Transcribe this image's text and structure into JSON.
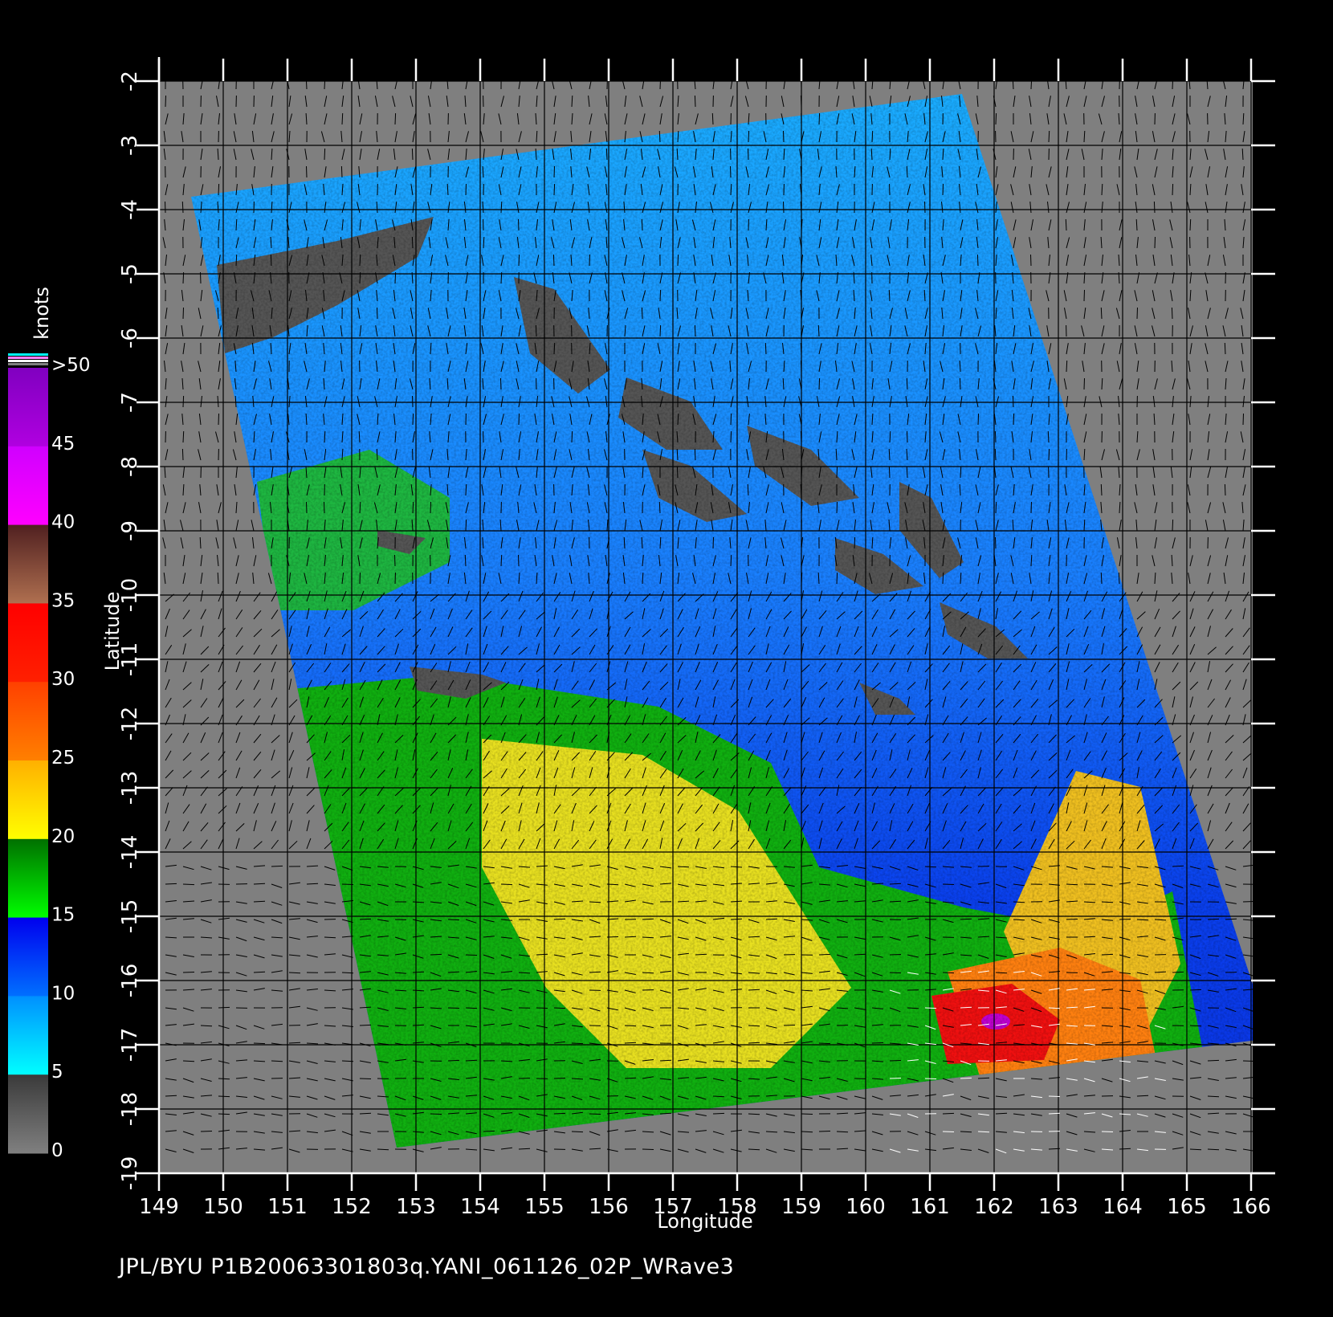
{
  "chart_data": {
    "type": "map",
    "xlabel": "Longitude",
    "ylabel": "Latitude",
    "xlim": [
      149,
      166
    ],
    "ylim": [
      -19,
      -2
    ],
    "x_ticks": [
      149,
      150,
      151,
      152,
      153,
      154,
      155,
      156,
      157,
      158,
      159,
      160,
      161,
      162,
      163,
      164,
      165,
      166
    ],
    "y_ticks": [
      -2,
      -3,
      -4,
      -5,
      -6,
      -7,
      -8,
      -9,
      -10,
      -11,
      -12,
      -13,
      -14,
      -15,
      -16,
      -17,
      -18,
      -19
    ],
    "grid": true,
    "swath_corners_lonlat": [
      [
        149.5,
        -3.8
      ],
      [
        161.5,
        -2.2
      ],
      [
        166.3,
        -16.9
      ],
      [
        152.7,
        -18.6
      ]
    ],
    "colorbar": {
      "unit": "knots",
      "labels": [
        "0",
        "5",
        "10",
        "15",
        "20",
        "25",
        "30",
        "35",
        "40",
        "45",
        ">50"
      ],
      "bands": [
        {
          "from": 0,
          "to": 5,
          "colors": [
            "#808080",
            "#3a3a3a"
          ]
        },
        {
          "from": 5,
          "to": 10,
          "colors": [
            "#00ffff",
            "#0090ff"
          ]
        },
        {
          "from": 10,
          "to": 15,
          "colors": [
            "#0070ff",
            "#0000ee"
          ]
        },
        {
          "from": 15,
          "to": 20,
          "colors": [
            "#00ff00",
            "#007000"
          ]
        },
        {
          "from": 20,
          "to": 25,
          "colors": [
            "#ffff00",
            "#ffb000"
          ]
        },
        {
          "from": 25,
          "to": 30,
          "colors": [
            "#ff8000",
            "#ff4000"
          ]
        },
        {
          "from": 30,
          "to": 35,
          "colors": [
            "#ff2000",
            "#ff0000"
          ]
        },
        {
          "from": 35,
          "to": 40,
          "colors": [
            "#b07050",
            "#502020"
          ]
        },
        {
          "from": 40,
          "to": 45,
          "colors": [
            "#ff00ff",
            "#d000ff"
          ]
        },
        {
          "from": 45,
          "to": 50,
          "colors": [
            "#b000e0",
            "#8000c0"
          ]
        }
      ]
    }
  },
  "footer": "JPL/BYU  P1B20063301803q.YANI_061126_02P_WRave3"
}
